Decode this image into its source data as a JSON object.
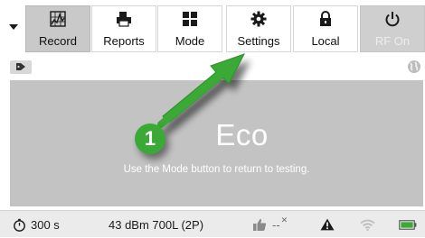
{
  "toolbar": {
    "dropdown_icon": "chevron-down-icon",
    "buttons": [
      {
        "label": "Record",
        "icon": "spectrum-icon",
        "state": "active"
      },
      {
        "label": "Reports",
        "icon": "printer-icon",
        "state": "normal"
      },
      {
        "label": "Mode",
        "icon": "grid-icon",
        "state": "normal"
      },
      {
        "label": "Settings",
        "icon": "gear-icon",
        "state": "normal"
      },
      {
        "label": "Local",
        "icon": "lock-icon",
        "state": "normal"
      },
      {
        "label": "RF On",
        "icon": "power-icon",
        "state": "disabled"
      }
    ]
  },
  "status_row": {
    "tag_icon": "tag-icon",
    "globe_icon": "globe-icon"
  },
  "panel": {
    "mode_title": "Eco",
    "hint": "Use the Mode button to return to testing."
  },
  "annotation": {
    "step_number": "1",
    "arrow_color": "#3aa935"
  },
  "statusbar": {
    "timer_icon": "stopwatch-icon",
    "timer_value": "300 s",
    "signal_info": "43 dBm 700L (2P)",
    "thumb_icon": "thumbs-up-icon",
    "thumb_value": "--",
    "warning_icon": "warning-icon",
    "wifi_icon": "wifi-icon",
    "battery_icon": "battery-icon",
    "battery_color": "#3aa935"
  }
}
